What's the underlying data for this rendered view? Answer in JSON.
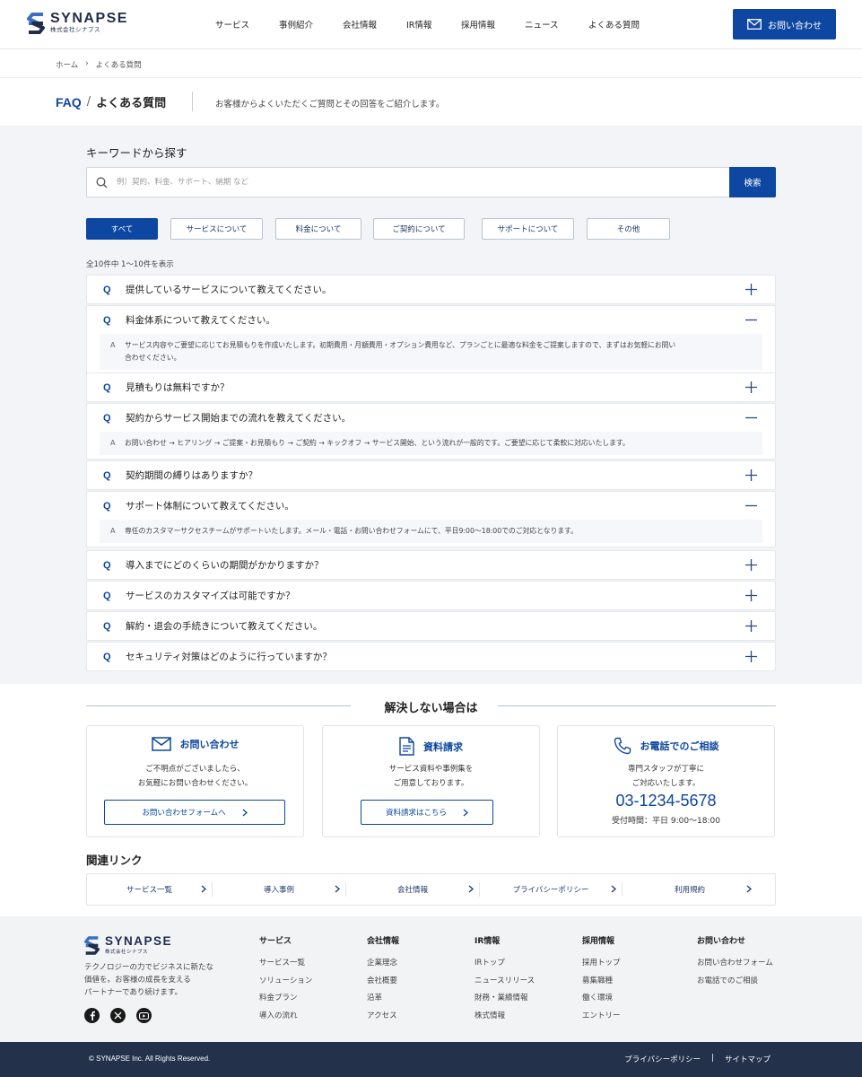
{
  "header": {
    "logo_name": "SYNAPSE",
    "logo_sub": "株式会社シナプス",
    "nav": [
      "サービス",
      "事例紹介",
      "会社情報",
      "IR情報",
      "採用情報",
      "ニュース",
      "よくある質問"
    ],
    "contact_label": "お問い合わせ"
  },
  "breadcrumb": {
    "home": "ホーム",
    "sep": "›",
    "current": "よくある質問"
  },
  "title": {
    "en": "FAQ",
    "slash": "/",
    "jp": "よくある質問",
    "desc": "お客様からよくいただくご質問とその回答をご紹介します。"
  },
  "search": {
    "label": "キーワードから探す",
    "placeholder": "例）契約、料金、サポート、納期 など",
    "button": "検索"
  },
  "tabs": [
    "すべて",
    "サービスについて",
    "料金について",
    "ご契約について",
    "サポートについて",
    "その他"
  ],
  "count_text": "全10件中 1〜10件を表示",
  "faq": {
    "q_mark": "Q",
    "a_mark": "A",
    "items": [
      {
        "q": "提供しているサービスについて教えてください。",
        "open": false
      },
      {
        "q": "料金体系について教えてください。",
        "open": true,
        "a1": "サービス内容やご要望に応じてお見積もりを作成いたします。初期費用・月額費用・オプション費用など、プランごとに最適な料金をご提案しますので、まずはお気軽にお問い",
        "a2": "合わせください。"
      },
      {
        "q": "見積もりは無料ですか？",
        "open": false
      },
      {
        "q": "契約からサービス開始までの流れを教えてください。",
        "open": true,
        "a1": "お問い合わせ → ヒアリング → ご提案・お見積もり → ご契約 → キックオフ → サービス開始、という流れが一般的です。ご要望に応じて柔軟に対応いたします。"
      },
      {
        "q": "契約期間の縛りはありますか？",
        "open": false
      },
      {
        "q": "サポート体制について教えてください。",
        "open": true,
        "a1": "専任のカスタマーサクセスチームがサポートいたします。メール・電話・お問い合わせフォームにて、平日9:00〜18:00でのご対応となります。"
      },
      {
        "q": "導入までにどのくらいの期間がかかりますか？",
        "open": false
      },
      {
        "q": "サービスのカスタマイズは可能ですか？",
        "open": false
      },
      {
        "q": "解約・退会の手続きについて教えてください。",
        "open": false
      },
      {
        "q": "セキュリティ対策はどのように行っていますか？",
        "open": false
      }
    ]
  },
  "unresolved": {
    "title": "解決しない場合は",
    "contact": {
      "title": "お問い合わせ",
      "line1": "ご不明点がございましたら、",
      "line2": "お気軽にお問い合わせください。",
      "button": "お問い合わせフォームへ"
    },
    "docs": {
      "title": "資料請求",
      "line1": "サービス資料や事例集を",
      "line2": "ご用意しております。",
      "button": "資料請求はこちら"
    },
    "phone": {
      "title": "お電話でのご相談",
      "line1": "専門スタッフが丁寧に",
      "line2": "ご対応いたします。",
      "number": "03-1234-5678",
      "hours": "受付時間：平日 9:00〜18:00"
    }
  },
  "related": {
    "title": "関連リンク",
    "items": [
      "サービス一覧",
      "導入事例",
      "会社情報",
      "プライバシーポリシー",
      "利用規約"
    ]
  },
  "footer": {
    "tagline1": "テクノロジーの力でビジネスに新たな",
    "tagline2": "価値を。お客様の成長を支える",
    "tagline3": "パートナーであり続けます。",
    "cols": [
      {
        "title": "サービス",
        "links": [
          "サービス一覧",
          "ソリューション",
          "料金プラン",
          "導入の流れ"
        ]
      },
      {
        "title": "会社情報",
        "links": [
          "企業理念",
          "会社概要",
          "沿革",
          "アクセス"
        ]
      },
      {
        "title": "IR情報",
        "links": [
          "IRトップ",
          "ニュースリリース",
          "財務・業績情報",
          "株式情報"
        ]
      },
      {
        "title": "採用情報",
        "links": [
          "採用トップ",
          "募集職種",
          "働く環境",
          "エントリー"
        ]
      },
      {
        "title": "お問い合わせ",
        "links": [
          "お問い合わせフォーム",
          "お電話でのご相談"
        ]
      }
    ],
    "copyright": "© SYNAPSE Inc. All Rights Reserved.",
    "privacy": "プライバシーポリシー",
    "bottom_sep": "|",
    "sitemap": "サイトマップ"
  },
  "colors": {
    "accent": "#0d47a1",
    "footer_bottom": "#23314a",
    "page_grey": "#f2f4f7"
  }
}
